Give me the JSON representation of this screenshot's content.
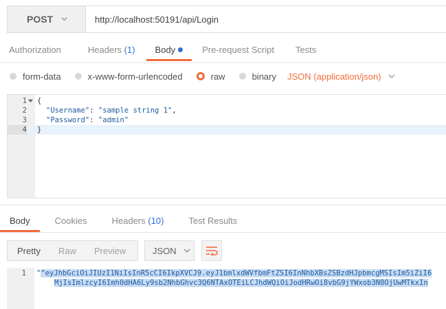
{
  "request": {
    "method": "POST",
    "url": "http://localhost:50191/api/Login"
  },
  "request_tabs": [
    {
      "label": "Authorization",
      "count": ""
    },
    {
      "label": "Headers",
      "count": "(1)"
    },
    {
      "label": "Body",
      "count": ""
    },
    {
      "label": "Pre-request Script",
      "count": ""
    },
    {
      "label": "Tests",
      "count": ""
    }
  ],
  "body_types": {
    "form_data": "form-data",
    "urlencoded": "x-www-form-urlencoded",
    "raw": "raw",
    "binary": "binary",
    "content_type": "JSON (application/json)"
  },
  "request_body": {
    "lines": [
      "1",
      "2",
      "3",
      "4"
    ],
    "open_brace": "{",
    "username_key": "\"Username\"",
    "username_value": "\"sample string 1\"",
    "password_key": "\"Password\"",
    "password_value": "\"admin\"",
    "close_brace": "}"
  },
  "response_tabs": [
    {
      "label": "Body",
      "count": ""
    },
    {
      "label": "Cookies",
      "count": ""
    },
    {
      "label": "Headers",
      "count": "(10)"
    },
    {
      "label": "Test Results",
      "count": ""
    }
  ],
  "view": {
    "pretty": "Pretty",
    "raw": "Raw",
    "preview": "Preview",
    "format": "JSON"
  },
  "response_body": {
    "line_no": "1",
    "line1": "\"eyJhbGciOiJIUzI1NiIsInR5cCI6IkpXVCJ9.eyJ1bmlxdWVfbmFtZSI6InNhbXBsZSBzdHJpbmcgMSIsIm5iZiI6",
    "line2": "MjIsImlzcyI6Imh0dHA6Ly9sb2NhbGhvc3Q6NTAxOTEiLCJhdWQiOiJodHRwOi8vbG9jYWxob3N0OjUwMTkxIn"
  },
  "colors": {
    "accent": "#f26b3a",
    "link": "#2f6fce",
    "selection": "#c8dcf4"
  }
}
